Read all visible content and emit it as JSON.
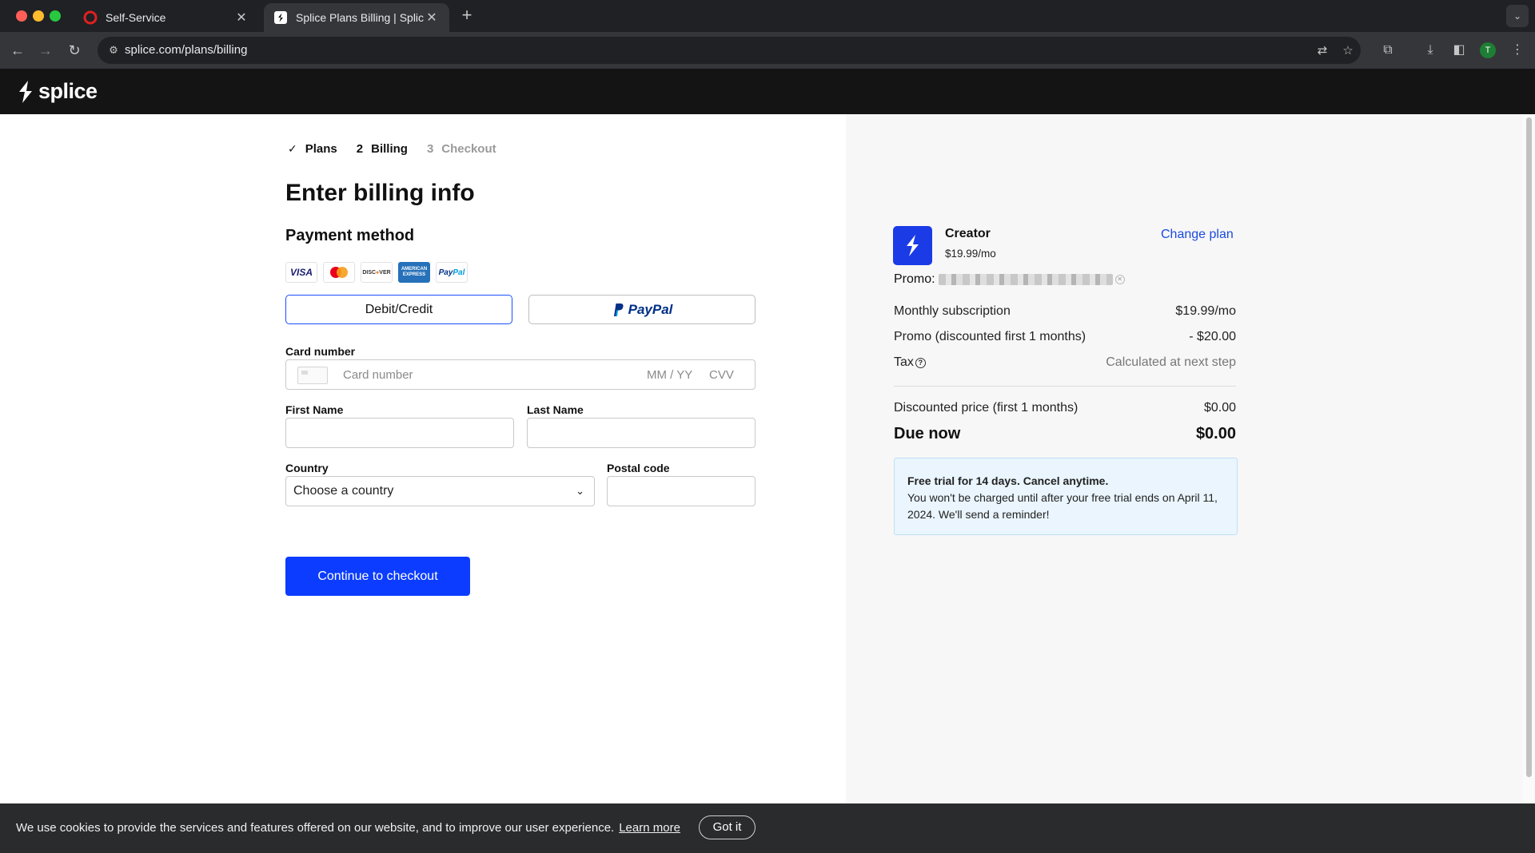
{
  "browser": {
    "tabs": [
      {
        "title": "Self-Service",
        "active": false
      },
      {
        "title": "Splice Plans Billing | Splice",
        "active": true
      }
    ],
    "url": "splice.com/plans/billing",
    "profile_initial": "T"
  },
  "site": {
    "brand": "splice"
  },
  "steps": [
    {
      "num": "✓",
      "label": "Plans",
      "state": "done"
    },
    {
      "num": "2",
      "label": "Billing",
      "state": "current"
    },
    {
      "num": "3",
      "label": "Checkout",
      "state": "pending"
    }
  ],
  "form": {
    "title": "Enter billing info",
    "payment_method_heading": "Payment method",
    "card_brands": [
      "VISA",
      "MasterCard",
      "DISCOVER",
      "AMERICAN EXPRESS",
      "PayPal"
    ],
    "tabs": {
      "debit": "Debit/Credit",
      "paypal": "PayPal"
    },
    "card_number_label": "Card number",
    "card_number_placeholder": "Card number",
    "expiry_placeholder": "MM / YY",
    "cvv_placeholder": "CVV",
    "first_name_label": "First Name",
    "first_name_value": "",
    "last_name_label": "Last Name",
    "last_name_value": "",
    "country_label": "Country",
    "country_value": "Choose a country",
    "postal_label": "Postal code",
    "postal_value": "",
    "submit_label": "Continue to checkout"
  },
  "summary": {
    "plan_name": "Creator",
    "plan_price": "$19.99/mo",
    "change_plan": "Change plan",
    "promo_label": "Promo:",
    "rows": [
      {
        "label": "Monthly subscription",
        "value": "$19.99/mo"
      },
      {
        "label": "Promo (discounted first 1 months)",
        "value": "- $20.00"
      },
      {
        "label": "Tax",
        "value": "Calculated at next step"
      },
      {
        "label": "Discounted price (first 1 months)",
        "value": "$0.00"
      }
    ],
    "due_label": "Due now",
    "due_value": "$0.00",
    "trial_title": "Free trial for 14 days. Cancel anytime.",
    "trial_body": "You won't be charged until after your free trial ends on April 11, 2024. We'll send a reminder!"
  },
  "cookie": {
    "message": "We use cookies to provide the services and features offered on our website, and to improve our user experience.",
    "learn_more": "Learn more",
    "got_it": "Got it"
  },
  "colors": {
    "primary": "#0b3cff",
    "link": "#1a4ae0",
    "header_bg": "#141414",
    "trial_bg": "#eaf5fd"
  }
}
